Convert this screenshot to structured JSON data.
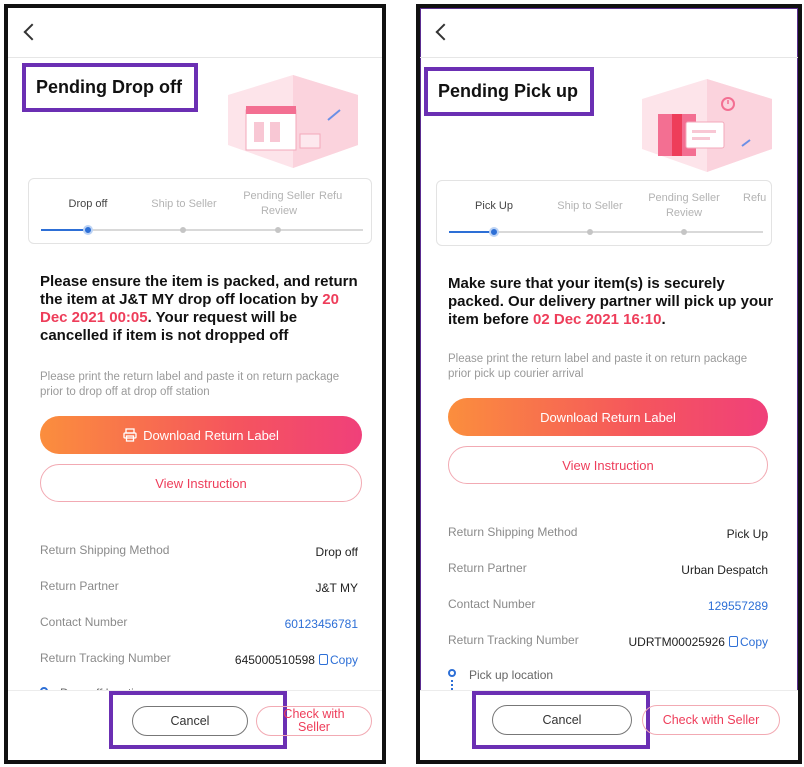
{
  "left": {
    "status_title": "Pending Drop off",
    "steps": [
      "Drop off",
      "Ship to Seller",
      "Pending Seller Review",
      "Refu"
    ],
    "headline_pre": "Please ensure the item is packed, and return the item at J&T MY drop off location by ",
    "headline_date": "20 Dec 2021 00:05",
    "headline_post": ". Your request will be cancelled if item is not dropped off",
    "note": "Please print the return label and paste it on return package prior to drop off at drop off station",
    "download_label": "Download Return Label",
    "instruction_label": "View Instruction",
    "rows": [
      {
        "label": "Return Shipping Method",
        "value": "Drop off"
      },
      {
        "label": "Return Partner",
        "value": "J&T MY"
      },
      {
        "label": "Contact Number",
        "value": "60123456781"
      },
      {
        "label": "Return Tracking Number",
        "value": "645000510598"
      }
    ],
    "copy_label": "Copy",
    "location_label": "Drop off location",
    "cancel_label": "Cancel",
    "check_label": "Check with Seller"
  },
  "right": {
    "status_title": "Pending Pick up",
    "steps": [
      "Pick Up",
      "Ship to Seller",
      "Pending Seller Review",
      "Refu"
    ],
    "headline_pre": "Make sure that your item(s) is securely packed. Our delivery partner will pick up your item before ",
    "headline_date": "02 Dec 2021 16:10",
    "headline_post": ".",
    "note": "Please print the return label and paste it on return package prior pick up courier arrival",
    "download_label": "Download Return Label",
    "instruction_label": "View Instruction",
    "rows": [
      {
        "label": "Return Shipping Method",
        "value": "Pick Up"
      },
      {
        "label": "Return Partner",
        "value": "Urban Despatch"
      },
      {
        "label": "Contact Number",
        "value": "129557289"
      },
      {
        "label": "Return Tracking Number",
        "value": "UDRTM00025926"
      }
    ],
    "copy_label": "Copy",
    "location_label": "Pick up location",
    "cancel_label": "Cancel",
    "check_label": "Check with Seller"
  },
  "colors": {
    "accent": "#ee3d5a",
    "link": "#2d6fd6",
    "highlight": "#6b2fb3"
  }
}
